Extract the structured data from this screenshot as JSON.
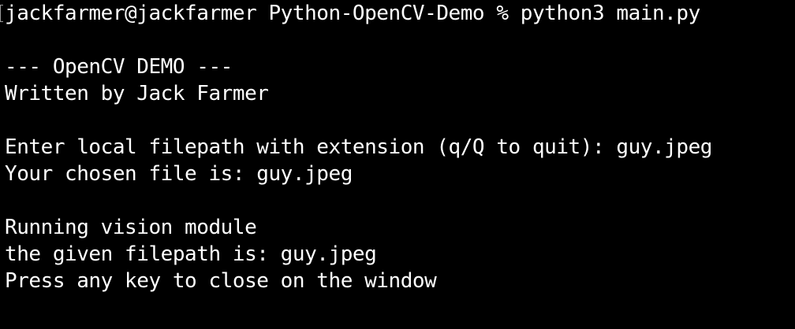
{
  "terminal": {
    "background": "#000000",
    "foreground": "#ffffff",
    "lines": [
      "jackfarmer@jackfarmer Python-OpenCV-Demo % python3 main.py",
      "",
      "--- OpenCV DEMO ---",
      "Written by Jack Farmer",
      "",
      "Enter local filepath with extension (q/Q to quit): guy.jpeg",
      "Your chosen file is: guy.jpeg",
      "",
      "Running vision module",
      "the given filepath is: guy.jpeg",
      "Press any key to close on the window"
    ]
  }
}
